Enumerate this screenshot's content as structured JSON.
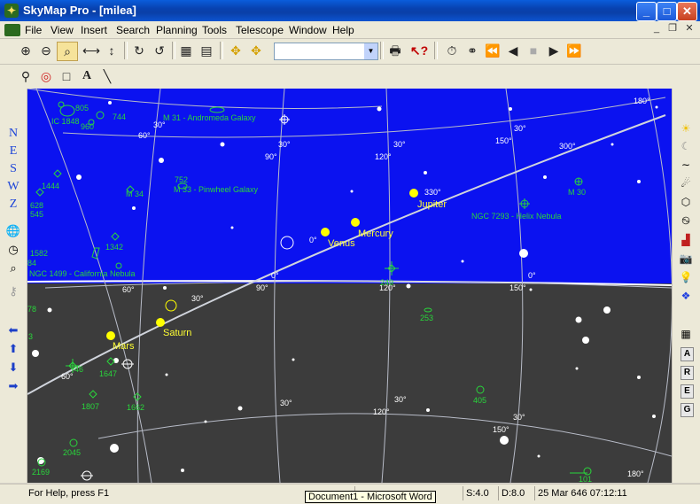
{
  "window": {
    "title": "SkyMap Pro - [milea]",
    "min_icon": "minimize-icon",
    "max_icon": "maximize-icon",
    "close_icon": "close-icon"
  },
  "menu": [
    "File",
    "View",
    "Insert",
    "Search",
    "Planning",
    "Tools",
    "Telescope",
    "Window",
    "Help"
  ],
  "toolbar": {
    "combo_value": ""
  },
  "left_tools": {
    "directions": [
      "N",
      "E",
      "S",
      "W",
      "Z"
    ]
  },
  "right_tools": {
    "boxes": [
      "A",
      "R",
      "E",
      "G"
    ]
  },
  "map": {
    "colors": {
      "sky": "#0b12f0",
      "ground": "#3c3c3c",
      "catalog": "#29d63b",
      "planet": "#ffff00"
    },
    "objects": [
      "M 31 - Andromeda Galaxy",
      "M 33 - Pinwheel Galaxy",
      "M 34",
      "M 30",
      "NGC 7293 - Helix Nebula",
      "NGC 1499 - California Nebula",
      "IC 1848",
      "805",
      "744",
      "960",
      "752",
      "1444",
      "628",
      "545",
      "1342",
      "1582",
      "84",
      "78",
      "253",
      "3",
      "46",
      "1647",
      "1807",
      "1662",
      "405",
      "2045",
      "2169",
      "101",
      "249"
    ],
    "planets": [
      "Jupiter",
      "Venus",
      "Mercury",
      "Mars",
      "Saturn"
    ],
    "grid_labels": [
      "30°",
      "60°",
      "90°",
      "120°",
      "150°",
      "180°",
      "300°",
      "330°",
      "0°"
    ]
  },
  "status": {
    "help": "For Help, press F1",
    "scale": "S:4.0",
    "density": "D:8.0",
    "datetime": "25 Mar 646 07:12:11"
  },
  "taskbar_tip": "Document1 - Microsoft Word"
}
